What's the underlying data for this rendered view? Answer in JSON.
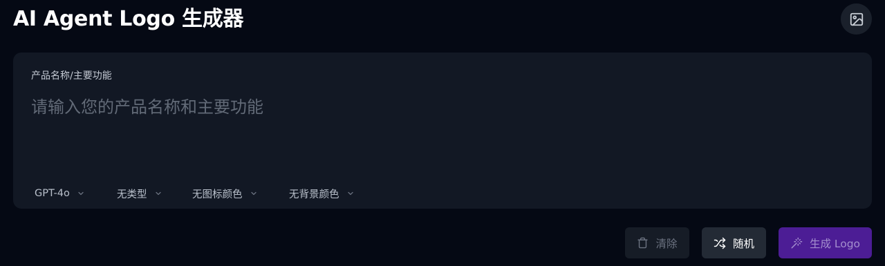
{
  "header": {
    "title": "AI Agent Logo 生成器",
    "gallery_icon": "image-icon"
  },
  "form": {
    "field_label": "产品名称/主要功能",
    "prompt_placeholder": "请输入您的产品名称和主要功能",
    "prompt_value": ""
  },
  "selects": [
    {
      "value": "GPT-4o",
      "icon": "chevron-down-icon"
    },
    {
      "value": "无类型",
      "icon": "chevron-down-icon"
    },
    {
      "value": "无图标颜色",
      "icon": "chevron-down-icon"
    },
    {
      "value": "无背景颜色",
      "icon": "chevron-down-icon"
    }
  ],
  "actions": {
    "clear_label": "清除",
    "clear_icon": "trash-icon",
    "random_label": "随机",
    "random_icon": "shuffle-icon",
    "generate_label": "生成 Logo",
    "generate_icon": "magic-wand-icon"
  },
  "colors": {
    "background": "#050914",
    "card": "#121824",
    "accent": "#4c1d95",
    "placeholder": "#626a77"
  }
}
